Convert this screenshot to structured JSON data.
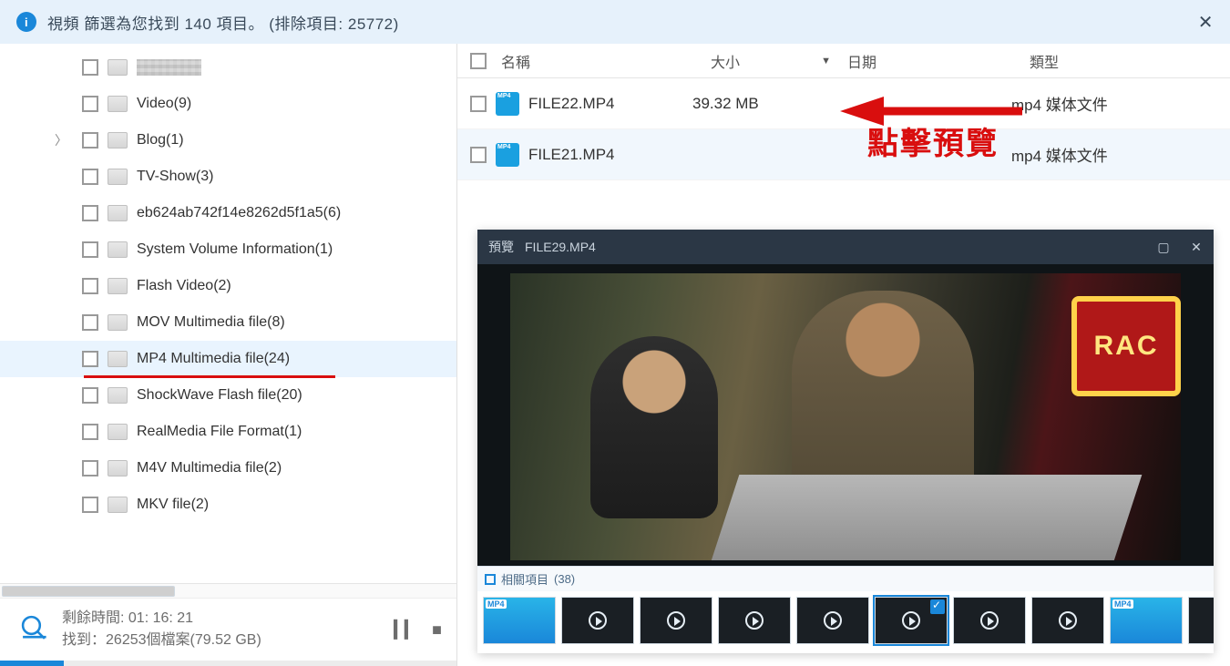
{
  "banner": {
    "text": "視頻 篩選為您找到 140 項目。 (排除項目: 25772)"
  },
  "tree": {
    "items": [
      {
        "label": "",
        "pixelated": true
      },
      {
        "label": "Video(9)"
      },
      {
        "label": "Blog(1)",
        "expandable": true
      },
      {
        "label": "TV-Show(3)"
      },
      {
        "label": "eb624ab742f14e8262d5f1a5(6)"
      },
      {
        "label": "System Volume Information(1)"
      },
      {
        "label": "Flash Video(2)"
      },
      {
        "label": "MOV Multimedia file(8)"
      },
      {
        "label": "MP4 Multimedia file(24)",
        "selected": true,
        "underlined": true
      },
      {
        "label": "ShockWave Flash file(20)"
      },
      {
        "label": "RealMedia File Format(1)"
      },
      {
        "label": "M4V Multimedia file(2)"
      },
      {
        "label": "MKV file(2)"
      }
    ]
  },
  "list": {
    "headers": {
      "name": "名稱",
      "size": "大小",
      "date": "日期",
      "type": "類型"
    },
    "rows": [
      {
        "name": "FILE22.MP4",
        "size": "39.32 MB",
        "type": "mp4 媒体文件"
      },
      {
        "name": "FILE21.MP4",
        "size": "",
        "type": "mp4 媒体文件",
        "alt": true
      }
    ]
  },
  "annotation": {
    "text": "點擊預覽"
  },
  "preview": {
    "title_prefix": "預覽",
    "file": "FILE29.MP4",
    "neon_text": "RAC",
    "related_label": "相關項目",
    "related_count": "(38)",
    "thumbs": [
      {
        "kind": "mp4",
        "label": "MP4"
      },
      {
        "kind": "vid"
      },
      {
        "kind": "vid"
      },
      {
        "kind": "vid"
      },
      {
        "kind": "vid"
      },
      {
        "kind": "vid",
        "selected": true,
        "checked": true
      },
      {
        "kind": "vid"
      },
      {
        "kind": "vid"
      },
      {
        "kind": "mp4",
        "label": "MP4"
      },
      {
        "kind": "vid"
      }
    ]
  },
  "status": {
    "time_label": "剩餘時間:",
    "time_value": "01: 16: 21",
    "found_label": "找到：",
    "found_value": "26253個檔案(79.52 GB)"
  }
}
